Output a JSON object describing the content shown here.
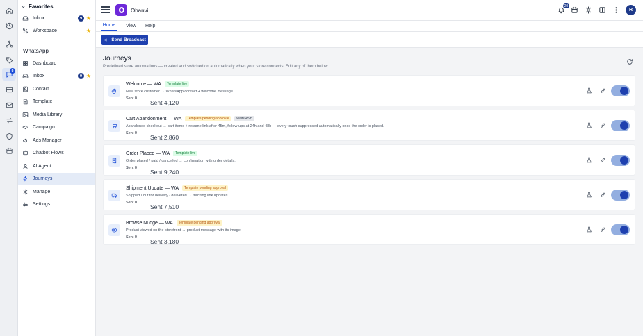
{
  "rail": {
    "items": [
      {
        "icon": "home-icon"
      },
      {
        "icon": "history-icon"
      },
      {
        "icon": "hierarchy-icon"
      },
      {
        "icon": "tag-icon"
      },
      {
        "icon": "chat-icon",
        "badge": "8"
      },
      {
        "icon": "credit-card-icon"
      },
      {
        "icon": "mail-icon"
      },
      {
        "icon": "transfer-icon"
      },
      {
        "icon": "shield-icon"
      },
      {
        "icon": "calendar-icon"
      }
    ]
  },
  "sidebar": {
    "favorites_title": "Favorites",
    "favorites": [
      {
        "label": "Inbox",
        "count": "9"
      },
      {
        "label": "Workspace"
      }
    ],
    "section_title": "WhatsApp",
    "items": [
      {
        "label": "Dashboard"
      },
      {
        "label": "Inbox",
        "count": "9"
      },
      {
        "label": "Contact"
      },
      {
        "label": "Template"
      },
      {
        "label": "Media Library"
      },
      {
        "label": "Campaign"
      },
      {
        "label": "Ads Manager"
      },
      {
        "label": "Chatbot Flows"
      },
      {
        "label": "AI Agent"
      },
      {
        "label": "Journeys"
      },
      {
        "label": "Manage"
      },
      {
        "label": "Settings"
      }
    ]
  },
  "header": {
    "brand": "Ohanvi",
    "notifications_count": "29",
    "avatar_initial": "R"
  },
  "tabs": [
    "Home",
    "View",
    "Help"
  ],
  "toolbar": {
    "broadcast_label": "Send Broadcast"
  },
  "main": {
    "title": "Journeys",
    "subtitle": "Predefined store automations — created and switched on automatically when your store connects. Edit any of them below.",
    "cards": [
      {
        "title": "Welcome — WA",
        "badge": "Template live",
        "badge_type": "live",
        "desc": "New store customer → WhatsApp contact + welcome message.",
        "sent0": "Sent 0",
        "sent": "Sent 4,120",
        "icon": "hand-wave-icon"
      },
      {
        "title": "Cart Abandonment — WA",
        "badge": "Template pending approval",
        "badge_type": "pending",
        "wait": "waits 45m",
        "desc": "Abandoned checkout → cart items + resume link after 45m, follow-ups at 24h and 48h — every touch suppressed automatically once the order is placed.",
        "sent0": "Sent 0",
        "sent": "Sent 2,860",
        "icon": "cart-icon"
      },
      {
        "title": "Order Placed — WA",
        "badge": "Template live",
        "badge_type": "live",
        "desc": "Order placed / paid / cancelled → confirmation with order details.",
        "sent0": "Sent 0",
        "sent": "Sent 9,240",
        "icon": "receipt-icon"
      },
      {
        "title": "Shipment Update — WA",
        "badge": "Template pending approval",
        "badge_type": "pending",
        "desc": "Shipped / out for delivery / delivered → tracking link updates.",
        "sent0": "Sent 0",
        "sent": "Sent 7,510",
        "icon": "truck-icon"
      },
      {
        "title": "Browse Nudge — WA",
        "badge": "Template pending approval",
        "badge_type": "pending",
        "desc": "Product viewed on the storefront → product message with its image.",
        "sent0": "Sent 0",
        "sent": "Sent 3,180",
        "icon": "eye-icon"
      }
    ]
  }
}
